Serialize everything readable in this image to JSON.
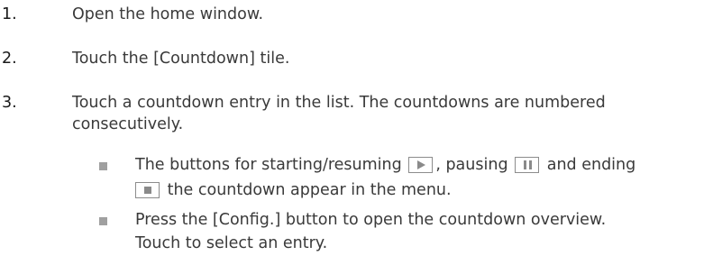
{
  "steps": [
    {
      "number": "1.",
      "text": "Open the home window."
    },
    {
      "number": "2.",
      "text": "Touch the [Countdown] tile."
    },
    {
      "number": "3.",
      "text_line1": "Touch a countdown entry in the list. The countdowns are numbered",
      "text_line2": "consecutively."
    }
  ],
  "bullets": [
    {
      "part1": "The buttons for starting/resuming",
      "part2": ", pausing",
      "part3": "and ending",
      "part4": "the countdown appear in the menu.",
      "icons": [
        "play-icon",
        "pause-icon",
        "stop-icon"
      ]
    },
    {
      "line1": "Press the [Config.] button to open the countdown overview.",
      "line2": "Touch to select an entry."
    }
  ]
}
